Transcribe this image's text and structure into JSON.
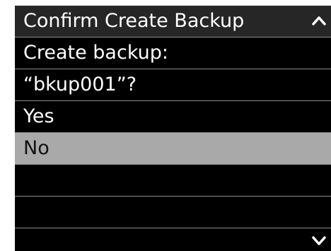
{
  "dialog": {
    "title": "Confirm Create Backup",
    "message_line1": "Create backup:",
    "message_line2": "“bkup001”?",
    "options": [
      "Yes",
      "No"
    ],
    "selected_option": "No"
  },
  "icons": {
    "scroll_up": "chevron-up-icon",
    "scroll_down": "chevron-down-icon"
  },
  "colors": {
    "background": "#000000",
    "title_bar": "#262626",
    "selection_highlight": "#a9a9a9",
    "separator": "#8c8c8c",
    "text": "#ffffff"
  }
}
